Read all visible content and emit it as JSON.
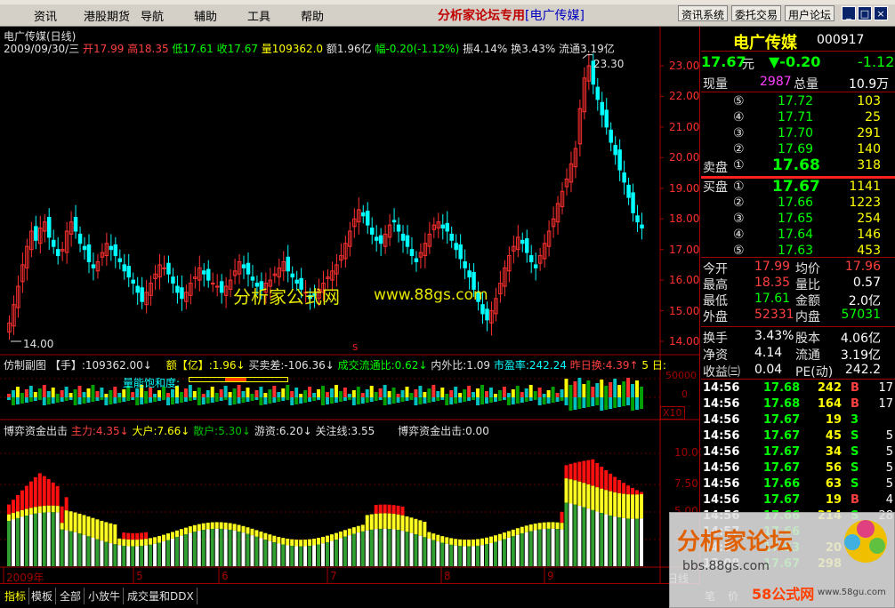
{
  "menu": {
    "items": [
      "资讯",
      "港股期货",
      "导航",
      "辅助",
      "工具",
      "帮助"
    ],
    "center_title": "分析家论坛专用",
    "center_stock": "[电广传媒]",
    "buttons": [
      "资讯系统",
      "委托交易",
      "用户论坛"
    ],
    "window_buttons": [
      "_",
      "□",
      "×"
    ]
  },
  "chart": {
    "stock_title": "电广传媒(日线)",
    "info_date": "2009/09/30/三",
    "info_open": "开17.99",
    "info_high": "高18.35",
    "info_low": "低17.61",
    "info_close": "收17.67",
    "info_vol": "量109362.0",
    "info_amount": "额1.96亿",
    "info_change": "幅-0.20(-1.12%)",
    "info_amp": "振4.14%",
    "info_turn": "换3.43%",
    "info_float": "流通3.19亿",
    "high_label": "23.30",
    "low_label": "14.00",
    "s_marker": "S",
    "watermark1": "分析家公式网",
    "watermark2": "www.88gs.com",
    "price_axis": [
      "23.00",
      "22.00",
      "21.00",
      "20.00",
      "19.00",
      "18.00",
      "17.00",
      "16.00",
      "15.00",
      "14.00"
    ],
    "sub1": {
      "label_name": "仿制副图",
      "label_unit": "【手】",
      "label_vol": ":109362.00↓",
      "label_amount_name": "额【亿】",
      "label_amount_val": ":1.96↓",
      "label_diff": "买卖差:-106.36↓",
      "label_flow": "成交流通比:0.62↓",
      "label_inout": "内外比:1.09",
      "label_pe": "市盈率:242.24",
      "label_prev": "昨日换:4.39↑",
      "label_days": "5 日:",
      "label_sat": "量能饱和度:",
      "axis_top": "50000",
      "axis_zero": "0",
      "axis_unit": "X10"
    },
    "sub2": {
      "label_name": "博弈资金出击",
      "label_main": "主力:4.35↓",
      "label_big": "大户:7.66↓",
      "label_retail": "散户:5.30↓",
      "label_travel": "游资:6.20↓",
      "label_focus": "关注线:3.55",
      "label_name2": "博弈资金出击:0.00",
      "axis": [
        "10.00",
        "7.50",
        "5.00",
        "2.50"
      ]
    },
    "date_axis": [
      "2009年",
      "5",
      "6",
      "7",
      "8",
      "9"
    ],
    "period": "日线"
  },
  "quote": {
    "name": "电广传媒",
    "code": "000917",
    "price": "17.67",
    "price_unit": "元",
    "change": "▼-0.20",
    "change_pct": "-1.12",
    "cur_vol_label": "现量",
    "cur_vol": "2987",
    "total_vol_label": "总量",
    "total_vol": "10.9万",
    "sell_label": "卖盘",
    "buy_label": "买盘",
    "sells": [
      {
        "no": "⑤",
        "price": "17.72",
        "vol": "103"
      },
      {
        "no": "④",
        "price": "17.71",
        "vol": "25"
      },
      {
        "no": "③",
        "price": "17.70",
        "vol": "291"
      },
      {
        "no": "②",
        "price": "17.69",
        "vol": "140"
      },
      {
        "no": "①",
        "price": "17.68",
        "vol": "318"
      }
    ],
    "buys": [
      {
        "no": "①",
        "price": "17.67",
        "vol": "1141"
      },
      {
        "no": "②",
        "price": "17.66",
        "vol": "1223"
      },
      {
        "no": "③",
        "price": "17.65",
        "vol": "254"
      },
      {
        "no": "④",
        "price": "17.64",
        "vol": "146"
      },
      {
        "no": "⑤",
        "price": "17.63",
        "vol": "453"
      }
    ],
    "stats": [
      {
        "l1": "今开",
        "v1": "17.99",
        "l2": "均价",
        "v2": "17.96",
        "c1": "#ff4040",
        "c2": "#ff4040"
      },
      {
        "l1": "最高",
        "v1": "18.35",
        "l2": "量比",
        "v2": "0.57",
        "c1": "#ff4040",
        "c2": "#ffffff"
      },
      {
        "l1": "最低",
        "v1": "17.61",
        "l2": "金额",
        "v2": "2.0亿",
        "c1": "#00ff00",
        "c2": "#ffffff"
      },
      {
        "l1": "外盘",
        "v1": "52331",
        "l2": "内盘",
        "v2": "57031",
        "c1": "#ff4040",
        "c2": "#00ff00"
      }
    ],
    "stats2": [
      {
        "l1": "换手",
        "v1": "3.43%",
        "l2": "股本",
        "v2": "4.06亿"
      },
      {
        "l1": "净资",
        "v1": "4.14",
        "l2": "流通",
        "v2": "3.19亿"
      },
      {
        "l1": "收益㈢",
        "v1": "0.04",
        "l2": "PE(动)",
        "v2": "242.2"
      }
    ],
    "ticks": [
      {
        "t": "14:56",
        "p": "17.68",
        "v": "242",
        "bs": "B",
        "n": "17",
        "pc": "#00ff00",
        "bc": "#ff4040"
      },
      {
        "t": "14:56",
        "p": "17.68",
        "v": "164",
        "bs": "B",
        "n": "17",
        "pc": "#00ff00",
        "bc": "#ff4040"
      },
      {
        "t": "14:56",
        "p": "17.67",
        "v": "19",
        "bs": "3",
        "n": "",
        "pc": "#00ff00",
        "bc": "#00ff00"
      },
      {
        "t": "14:56",
        "p": "17.67",
        "v": "45",
        "bs": "S",
        "n": "5",
        "pc": "#00ff00",
        "bc": "#00ff00"
      },
      {
        "t": "14:56",
        "p": "17.67",
        "v": "34",
        "bs": "S",
        "n": "5",
        "pc": "#00ff00",
        "bc": "#00ff00"
      },
      {
        "t": "14:56",
        "p": "17.67",
        "v": "56",
        "bs": "S",
        "n": "5",
        "pc": "#00ff00",
        "bc": "#00ff00"
      },
      {
        "t": "14:56",
        "p": "17.66",
        "v": "63",
        "bs": "S",
        "n": "5",
        "pc": "#00ff00",
        "bc": "#00ff00"
      },
      {
        "t": "14:56",
        "p": "17.67",
        "v": "19",
        "bs": "B",
        "n": "4",
        "pc": "#00ff00",
        "bc": "#ff4040"
      },
      {
        "t": "14:56",
        "p": "17.66",
        "v": "214",
        "bs": "S",
        "n": "28",
        "pc": "#00ff00",
        "bc": "#00ff00"
      },
      {
        "t": "14:57",
        "p": "17.66",
        "v": "",
        "bs": "",
        "n": "",
        "pc": "#00ff00",
        "bc": "#00ff00"
      },
      {
        "t": "14:57",
        "p": "17.63",
        "v": "20",
        "bs": "",
        "n": "",
        "pc": "#00ff00",
        "bc": "#00ff00"
      },
      {
        "t": "15:08",
        "p": "17.67",
        "v": "298",
        "bs": "",
        "n": "",
        "pc": "#00ff00",
        "bc": "#00ff00"
      }
    ],
    "bottom_tabs": [
      "笔",
      "价"
    ]
  },
  "tabs": [
    "指标",
    "模板",
    "全部",
    "小放牛",
    "成交量和DDX"
  ],
  "watermark": {
    "title": "分析家论坛",
    "url": "bbs.88gs.com",
    "url2": "www.58gu.com",
    "brand": "58公式网"
  }
}
